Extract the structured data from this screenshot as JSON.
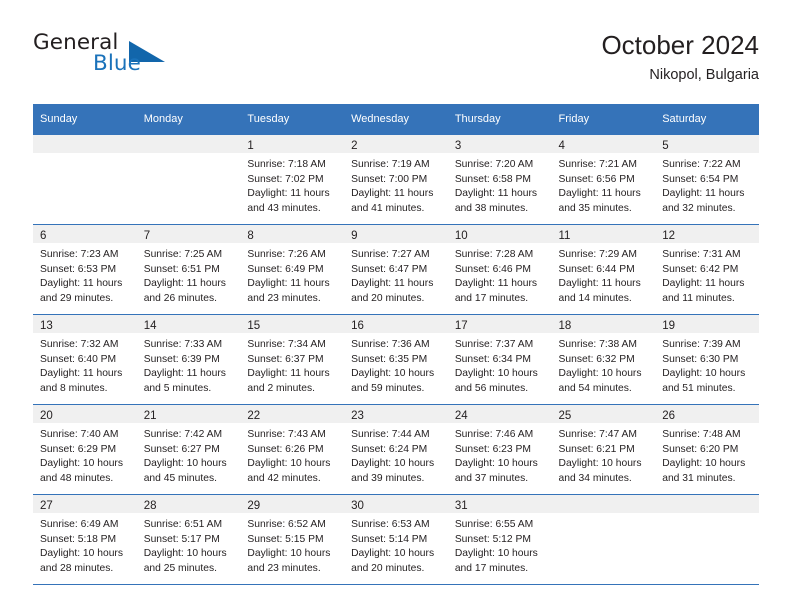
{
  "logo": {
    "text_top": "General",
    "text_bottom": "Blue",
    "triangle_color": "#1266ab",
    "blue_color": "#1a72ba",
    "dark_color": "#231f20"
  },
  "header": {
    "title": "October 2024",
    "subtitle": "Nikopol, Bulgaria"
  },
  "theme": {
    "header_bg": "#3573b9",
    "header_text": "#ffffff",
    "day_band_bg": "#f0f0f0",
    "cell_bg": "#ffffff",
    "text": "#231f20"
  },
  "weekday_headers": [
    "Sunday",
    "Monday",
    "Tuesday",
    "Wednesday",
    "Thursday",
    "Friday",
    "Saturday"
  ],
  "weeks": [
    [
      {
        "day": "",
        "lines": []
      },
      {
        "day": "",
        "lines": []
      },
      {
        "day": "1",
        "lines": [
          "Sunrise: 7:18 AM",
          "Sunset: 7:02 PM",
          "Daylight: 11 hours",
          "and 43 minutes."
        ]
      },
      {
        "day": "2",
        "lines": [
          "Sunrise: 7:19 AM",
          "Sunset: 7:00 PM",
          "Daylight: 11 hours",
          "and 41 minutes."
        ]
      },
      {
        "day": "3",
        "lines": [
          "Sunrise: 7:20 AM",
          "Sunset: 6:58 PM",
          "Daylight: 11 hours",
          "and 38 minutes."
        ]
      },
      {
        "day": "4",
        "lines": [
          "Sunrise: 7:21 AM",
          "Sunset: 6:56 PM",
          "Daylight: 11 hours",
          "and 35 minutes."
        ]
      },
      {
        "day": "5",
        "lines": [
          "Sunrise: 7:22 AM",
          "Sunset: 6:54 PM",
          "Daylight: 11 hours",
          "and 32 minutes."
        ]
      }
    ],
    [
      {
        "day": "6",
        "lines": [
          "Sunrise: 7:23 AM",
          "Sunset: 6:53 PM",
          "Daylight: 11 hours",
          "and 29 minutes."
        ]
      },
      {
        "day": "7",
        "lines": [
          "Sunrise: 7:25 AM",
          "Sunset: 6:51 PM",
          "Daylight: 11 hours",
          "and 26 minutes."
        ]
      },
      {
        "day": "8",
        "lines": [
          "Sunrise: 7:26 AM",
          "Sunset: 6:49 PM",
          "Daylight: 11 hours",
          "and 23 minutes."
        ]
      },
      {
        "day": "9",
        "lines": [
          "Sunrise: 7:27 AM",
          "Sunset: 6:47 PM",
          "Daylight: 11 hours",
          "and 20 minutes."
        ]
      },
      {
        "day": "10",
        "lines": [
          "Sunrise: 7:28 AM",
          "Sunset: 6:46 PM",
          "Daylight: 11 hours",
          "and 17 minutes."
        ]
      },
      {
        "day": "11",
        "lines": [
          "Sunrise: 7:29 AM",
          "Sunset: 6:44 PM",
          "Daylight: 11 hours",
          "and 14 minutes."
        ]
      },
      {
        "day": "12",
        "lines": [
          "Sunrise: 7:31 AM",
          "Sunset: 6:42 PM",
          "Daylight: 11 hours",
          "and 11 minutes."
        ]
      }
    ],
    [
      {
        "day": "13",
        "lines": [
          "Sunrise: 7:32 AM",
          "Sunset: 6:40 PM",
          "Daylight: 11 hours",
          "and 8 minutes."
        ]
      },
      {
        "day": "14",
        "lines": [
          "Sunrise: 7:33 AM",
          "Sunset: 6:39 PM",
          "Daylight: 11 hours",
          "and 5 minutes."
        ]
      },
      {
        "day": "15",
        "lines": [
          "Sunrise: 7:34 AM",
          "Sunset: 6:37 PM",
          "Daylight: 11 hours",
          "and 2 minutes."
        ]
      },
      {
        "day": "16",
        "lines": [
          "Sunrise: 7:36 AM",
          "Sunset: 6:35 PM",
          "Daylight: 10 hours",
          "and 59 minutes."
        ]
      },
      {
        "day": "17",
        "lines": [
          "Sunrise: 7:37 AM",
          "Sunset: 6:34 PM",
          "Daylight: 10 hours",
          "and 56 minutes."
        ]
      },
      {
        "day": "18",
        "lines": [
          "Sunrise: 7:38 AM",
          "Sunset: 6:32 PM",
          "Daylight: 10 hours",
          "and 54 minutes."
        ]
      },
      {
        "day": "19",
        "lines": [
          "Sunrise: 7:39 AM",
          "Sunset: 6:30 PM",
          "Daylight: 10 hours",
          "and 51 minutes."
        ]
      }
    ],
    [
      {
        "day": "20",
        "lines": [
          "Sunrise: 7:40 AM",
          "Sunset: 6:29 PM",
          "Daylight: 10 hours",
          "and 48 minutes."
        ]
      },
      {
        "day": "21",
        "lines": [
          "Sunrise: 7:42 AM",
          "Sunset: 6:27 PM",
          "Daylight: 10 hours",
          "and 45 minutes."
        ]
      },
      {
        "day": "22",
        "lines": [
          "Sunrise: 7:43 AM",
          "Sunset: 6:26 PM",
          "Daylight: 10 hours",
          "and 42 minutes."
        ]
      },
      {
        "day": "23",
        "lines": [
          "Sunrise: 7:44 AM",
          "Sunset: 6:24 PM",
          "Daylight: 10 hours",
          "and 39 minutes."
        ]
      },
      {
        "day": "24",
        "lines": [
          "Sunrise: 7:46 AM",
          "Sunset: 6:23 PM",
          "Daylight: 10 hours",
          "and 37 minutes."
        ]
      },
      {
        "day": "25",
        "lines": [
          "Sunrise: 7:47 AM",
          "Sunset: 6:21 PM",
          "Daylight: 10 hours",
          "and 34 minutes."
        ]
      },
      {
        "day": "26",
        "lines": [
          "Sunrise: 7:48 AM",
          "Sunset: 6:20 PM",
          "Daylight: 10 hours",
          "and 31 minutes."
        ]
      }
    ],
    [
      {
        "day": "27",
        "lines": [
          "Sunrise: 6:49 AM",
          "Sunset: 5:18 PM",
          "Daylight: 10 hours",
          "and 28 minutes."
        ]
      },
      {
        "day": "28",
        "lines": [
          "Sunrise: 6:51 AM",
          "Sunset: 5:17 PM",
          "Daylight: 10 hours",
          "and 25 minutes."
        ]
      },
      {
        "day": "29",
        "lines": [
          "Sunrise: 6:52 AM",
          "Sunset: 5:15 PM",
          "Daylight: 10 hours",
          "and 23 minutes."
        ]
      },
      {
        "day": "30",
        "lines": [
          "Sunrise: 6:53 AM",
          "Sunset: 5:14 PM",
          "Daylight: 10 hours",
          "and 20 minutes."
        ]
      },
      {
        "day": "31",
        "lines": [
          "Sunrise: 6:55 AM",
          "Sunset: 5:12 PM",
          "Daylight: 10 hours",
          "and 17 minutes."
        ]
      },
      {
        "day": "",
        "lines": []
      },
      {
        "day": "",
        "lines": []
      }
    ]
  ]
}
